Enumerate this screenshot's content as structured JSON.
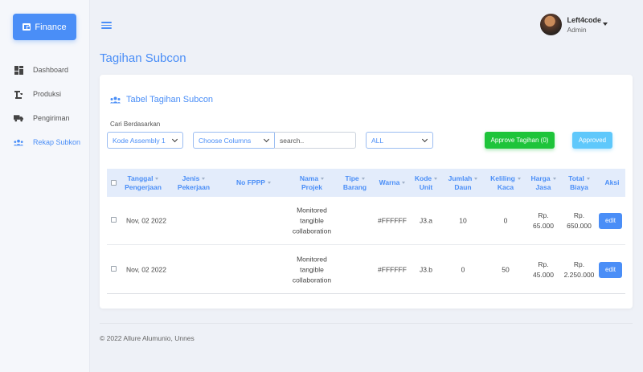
{
  "brand": {
    "label": "Finance"
  },
  "sidebar": {
    "items": [
      {
        "label": "Dashboard",
        "icon": "dashboard-icon",
        "active": false
      },
      {
        "label": "Produksi",
        "icon": "factory-icon",
        "active": false
      },
      {
        "label": "Pengiriman",
        "icon": "truck-icon",
        "active": false
      },
      {
        "label": "Rekap Subkon",
        "icon": "users-icon",
        "active": true
      }
    ]
  },
  "user": {
    "name": "Left4code",
    "role": "Admin"
  },
  "page": {
    "title": "Tagihan Subcon"
  },
  "card": {
    "title": "Tabel Tagihan Subcon",
    "filter_label": "Cari Berdasarkan",
    "select_assembly": "Kode Assembly 1",
    "select_columns": "Choose Columns",
    "search_placeholder": "search..",
    "select_status": "ALL",
    "approve_button": "Approve Tagihan (0)",
    "approved_button": "Approved"
  },
  "table": {
    "headers": {
      "tanggal": [
        "Tanggal",
        "Pengerjaan"
      ],
      "jenis": [
        "Jenis",
        "Pekerjaan"
      ],
      "fppp": "No FPPP",
      "nama": [
        "Nama",
        "Projek"
      ],
      "tipe": [
        "Tipe",
        "Barang"
      ],
      "warna": "Warna",
      "kode": [
        "Kode",
        "Unit"
      ],
      "jumlah": [
        "Jumlah",
        "Daun"
      ],
      "keliling": [
        "Keliling",
        "Kaca"
      ],
      "harga": [
        "Harga",
        "Jasa"
      ],
      "total": [
        "Total",
        "Biaya"
      ],
      "aksi": "Aksi"
    },
    "rows": [
      {
        "tanggal": "Nov, 02 2022",
        "nama": [
          "Monitored",
          "tangible",
          "collaboration"
        ],
        "warna": "#FFFFFF",
        "kode": "J3.a",
        "jumlah": "10",
        "keliling": "0",
        "harga": [
          "Rp.",
          "65.000"
        ],
        "total": [
          "Rp.",
          "650.000"
        ],
        "action": "edit"
      },
      {
        "tanggal": "Nov, 02 2022",
        "nama": [
          "Monitored",
          "tangible",
          "collaboration"
        ],
        "warna": "#FFFFFF",
        "kode": "J3.b",
        "jumlah": "0",
        "keliling": "50",
        "harga": [
          "Rp.",
          "45.000"
        ],
        "total": [
          "Rp.",
          "2.250.000"
        ],
        "action": "edit"
      }
    ]
  },
  "footer": {
    "text": "© 2022 Allure Alumunio, Unnes"
  },
  "colors": {
    "accent": "#4a8ef7",
    "approve": "#1ec43a",
    "approved": "#5fc8fb"
  }
}
